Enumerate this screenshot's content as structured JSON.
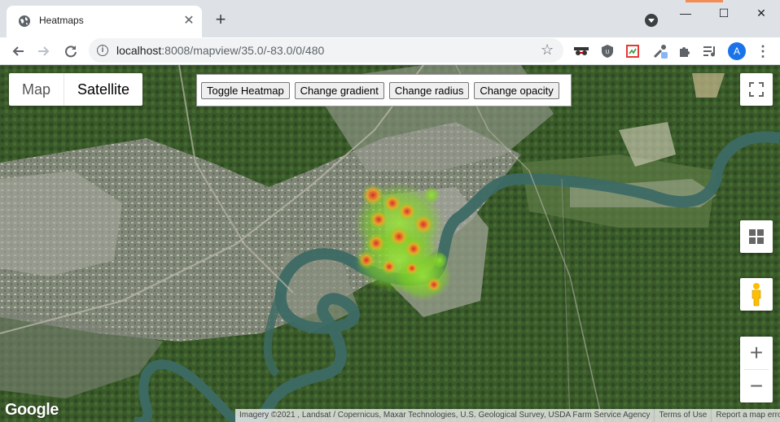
{
  "browser": {
    "tab_title": "Heatmaps",
    "tab_close": "✕",
    "new_tab": "+",
    "window_minimize": "—",
    "window_maximize": "☐",
    "window_close": "✕",
    "url_host": "localhost",
    "url_rest": ":8008/mapview/35.0/-83.0/0/480",
    "avatar_initial": "A"
  },
  "map": {
    "map_type_map": "Map",
    "map_type_satellite": "Satellite",
    "selected_map_type": "Satellite",
    "buttons": {
      "toggle": "Toggle Heatmap",
      "gradient": "Change gradient",
      "radius": "Change radius",
      "opacity": "Change opacity"
    },
    "zoom_in": "+",
    "zoom_out": "−",
    "logo": "Google",
    "attribution": "Imagery ©2021 , Landsat / Copernicus, Maxar Technologies, U.S. Geological Survey, USDA Farm Service Agency",
    "terms": "Terms of Use",
    "report": "Report a map error"
  },
  "colors": {
    "heat_low": "#7ed321",
    "heat_mid": "#f5a623",
    "heat_high": "#e0202a",
    "river": "#3c6a64"
  }
}
